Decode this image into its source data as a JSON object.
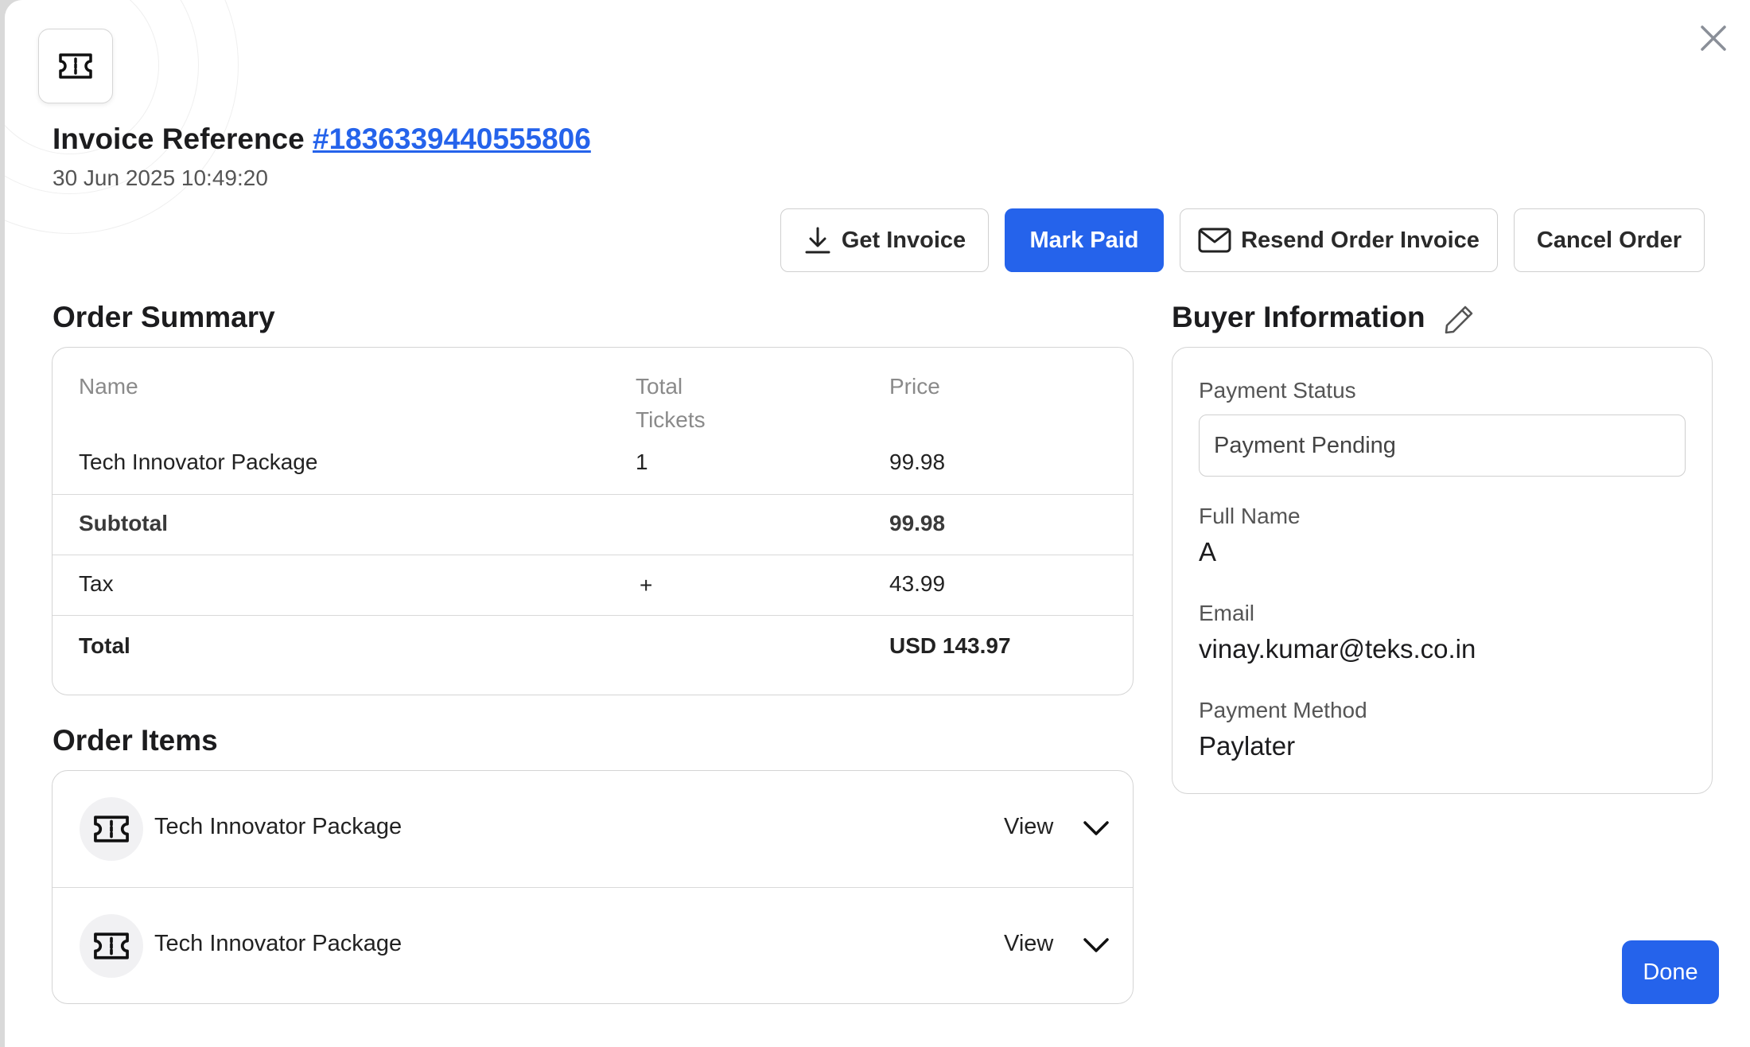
{
  "header": {
    "title_prefix": "Invoice Reference",
    "reference": "#1836339440555806",
    "datetime": "30 Jun 2025 10:49:20",
    "icon": "ticket-icon"
  },
  "actions": {
    "get_invoice": "Get Invoice",
    "mark_paid": "Mark Paid",
    "resend_invoice": "Resend Order Invoice",
    "cancel_order": "Cancel Order"
  },
  "order_summary": {
    "title": "Order Summary",
    "columns": [
      "Name",
      "Total Tickets",
      "Price"
    ],
    "columns_display": {
      "name": "Name",
      "tickets_line1": "Total",
      "tickets_line2": "Tickets",
      "price": "Price"
    },
    "items": [
      {
        "name": "Tech Innovator Package",
        "tickets": "1",
        "price": "99.98"
      }
    ],
    "subtotal": {
      "label": "Subtotal",
      "value": "99.98"
    },
    "tax": {
      "label": "Tax",
      "sign": "+",
      "value": "43.99"
    },
    "total": {
      "label": "Total",
      "value": "USD 143.97"
    }
  },
  "order_items": {
    "title": "Order Items",
    "items": [
      {
        "name": "Tech Innovator Package",
        "view": "View"
      },
      {
        "name": "Tech Innovator Package",
        "view": "View"
      }
    ]
  },
  "buyer": {
    "title": "Buyer Information",
    "payment_status_label": "Payment Status",
    "payment_status_value": "Payment Pending",
    "full_name_label": "Full Name",
    "full_name_value": "A",
    "email_label": "Email",
    "email_value": "vinay.kumar@teks.co.in",
    "payment_method_label": "Payment Method",
    "payment_method_value": "Paylater"
  },
  "footer": {
    "done": "Done"
  },
  "colors": {
    "primary": "#2563eb",
    "border": "#d4d4d4",
    "text": "#1c1c1e",
    "muted": "#8a8a8a"
  }
}
